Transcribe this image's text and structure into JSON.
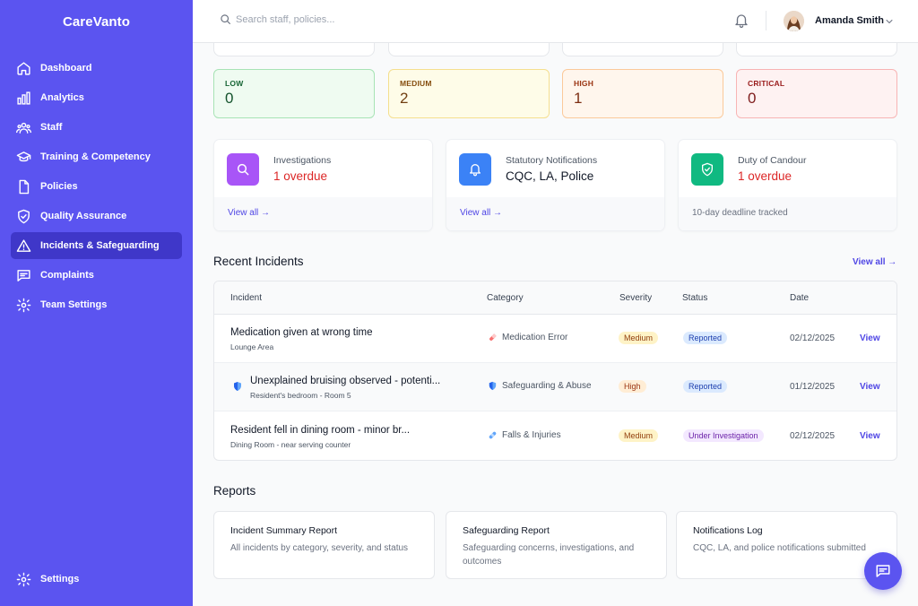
{
  "app": {
    "brand": "CareVanto"
  },
  "sidebar": {
    "items": [
      {
        "label": "Dashboard",
        "icon": "home-icon"
      },
      {
        "label": "Analytics",
        "icon": "bar-chart-icon"
      },
      {
        "label": "Staff",
        "icon": "users-icon"
      },
      {
        "label": "Training & Competency",
        "icon": "graduation-cap-icon"
      },
      {
        "label": "Policies",
        "icon": "document-icon"
      },
      {
        "label": "Quality Assurance",
        "icon": "shield-check-icon"
      },
      {
        "label": "Incidents & Safeguarding",
        "icon": "warning-triangle-icon",
        "active": true
      },
      {
        "label": "Complaints",
        "icon": "message-icon"
      },
      {
        "label": "Team Settings",
        "icon": "gear-icon"
      }
    ],
    "settings_label": "Settings"
  },
  "header": {
    "search_placeholder": "Search staff, policies...",
    "user_name": "Amanda Smith"
  },
  "severity": [
    {
      "label": "LOW",
      "value": "0"
    },
    {
      "label": "MEDIUM",
      "value": "2"
    },
    {
      "label": "HIGH",
      "value": "1"
    },
    {
      "label": "CRITICAL",
      "value": "0"
    }
  ],
  "overview": [
    {
      "title": "Investigations",
      "value": "1 overdue",
      "footer": "View all →",
      "icon": "search-icon"
    },
    {
      "title": "Statutory Notifications",
      "value": "CQC, LA, Police",
      "footer": "View all →",
      "icon": "bell-icon"
    },
    {
      "title": "Duty of Candour",
      "value": "1 overdue",
      "footer": "10-day deadline tracked",
      "icon": "shield-check-icon"
    }
  ],
  "recent": {
    "title": "Recent Incidents",
    "view_all": "View all →",
    "columns": [
      "Incident",
      "Category",
      "Severity",
      "Status",
      "Date"
    ],
    "rows": [
      {
        "title": "Medication given at wrong time",
        "location": "Lounge Area",
        "category": "Medication Error",
        "severity": "Medium",
        "status": "Reported",
        "date": "02/12/2025",
        "action": "View"
      },
      {
        "title": "Unexplained bruising observed - potenti...",
        "location": "Resident's bedroom - Room 5",
        "category": "Safeguarding & Abuse",
        "severity": "High",
        "status": "Reported",
        "date": "01/12/2025",
        "action": "View"
      },
      {
        "title": "Resident fell in dining room - minor br...",
        "location": "Dining Room - near serving counter",
        "category": "Falls & Injuries",
        "severity": "Medium",
        "status": "Under Investigation",
        "date": "02/12/2025",
        "action": "View"
      }
    ]
  },
  "reports": {
    "title": "Reports",
    "items": [
      {
        "title": "Incident Summary Report",
        "desc": "All incidents by category, severity, and status"
      },
      {
        "title": "Safeguarding Report",
        "desc": "Safeguarding concerns, investigations, and outcomes"
      },
      {
        "title": "Notifications Log",
        "desc": "CQC, LA, and police notifications submitted"
      }
    ]
  },
  "colors": {
    "accent": "#5b54f0",
    "sidebar_active": "#3f37c9",
    "overdue": "#dc2626",
    "link": "#4f46e5"
  }
}
